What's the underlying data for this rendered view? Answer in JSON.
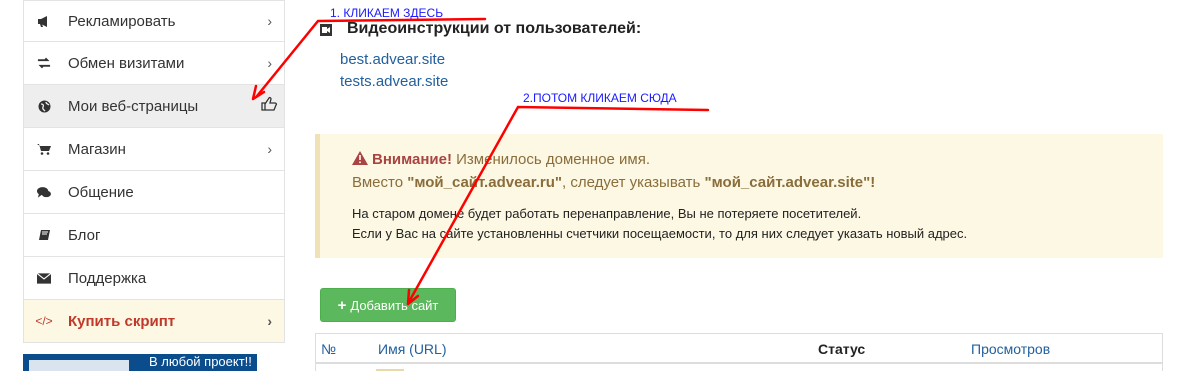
{
  "sidebar": {
    "items": [
      {
        "label": "Рекламировать",
        "icon": "bullhorn-icon",
        "chevron": "›"
      },
      {
        "label": "Обмен визитами",
        "icon": "exchange-icon",
        "chevron": "›"
      },
      {
        "label": "Мои веб-страницы",
        "icon": "globe-icon",
        "active": true
      },
      {
        "label": "Магазин",
        "icon": "cart-icon",
        "chevron": "›"
      },
      {
        "label": "Общение",
        "icon": "comments-icon"
      },
      {
        "label": "Блог",
        "icon": "book-icon"
      },
      {
        "label": "Поддержка",
        "icon": "envelope-icon"
      },
      {
        "label": "Купить скрипт",
        "icon": "code-icon",
        "icon_text": "</>",
        "chevron": "›"
      }
    ],
    "banner_text": "В любой проект!!"
  },
  "main": {
    "video_heading": "Видеоинструкции от пользователей:",
    "links": [
      "best.advear.site",
      "tests.advear.site"
    ],
    "alert": {
      "warn_label": "Внимание!",
      "line1_rest": " Изменилось доменное имя.",
      "line2_a": "Вместо ",
      "old_domain": "\"мой_сайт.advear.ru\"",
      "line2_b": ", следует указывать ",
      "new_domain": "\"мой_сайт.advear.site\"",
      "line2_c": "!",
      "line3": "На старом домене будет работать перенаправление, Вы не потеряете посетителей.",
      "line4": "Если у Вас на сайте установленны счетчики посещаемости, то для них следует указать новый адрес."
    },
    "add_button": {
      "plus": "+",
      "label": "Добавить сайт"
    },
    "table": {
      "headers": {
        "num": "№",
        "name": "Имя (URL)",
        "status": "Статус",
        "views": "Просмотров"
      }
    }
  },
  "annotations": {
    "step1": "1. КЛИКАЕМ ЗДЕСЬ",
    "step2": "2.ПОТОМ КЛИКАЕМ СЮДА",
    "color": "#ff0000"
  },
  "colors": {
    "link": "#23609e",
    "success": "#5cb85c",
    "warning_bg": "#fcf8e3",
    "danger": "#a94442",
    "banner": "#0b4d8c"
  }
}
